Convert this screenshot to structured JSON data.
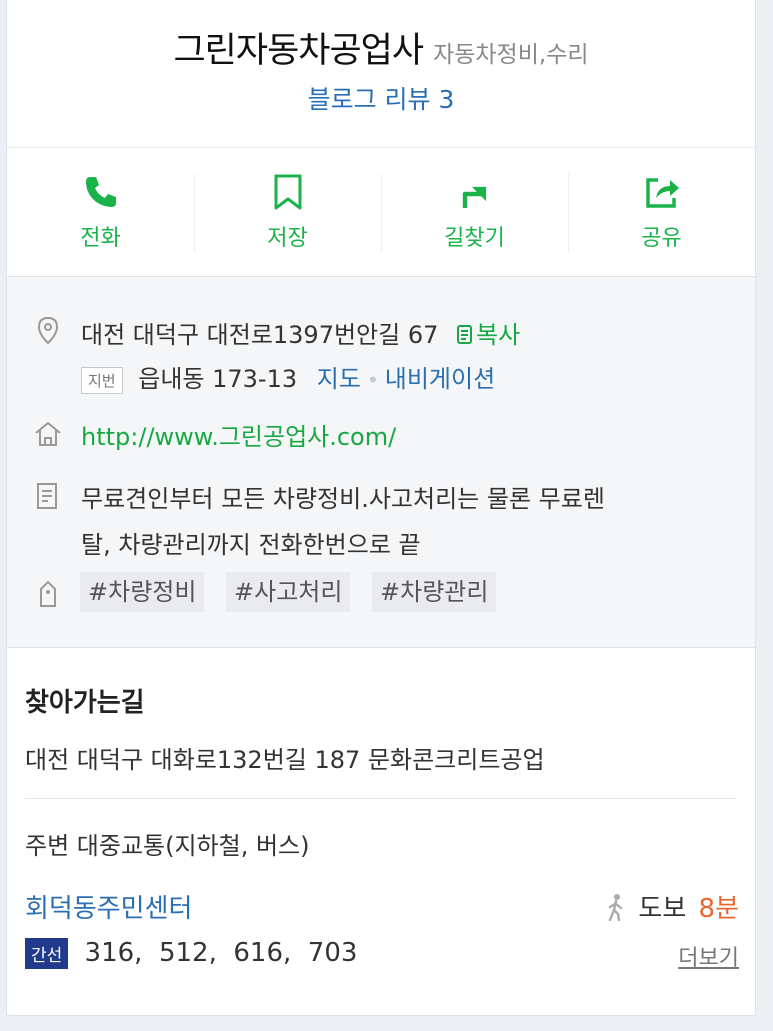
{
  "place": {
    "name": "그린자동차공업사",
    "category": "자동차정비,수리",
    "review_label": "블로그 리뷰 3"
  },
  "actions": [
    {
      "label": "전화",
      "icon": "phone-icon"
    },
    {
      "label": "저장",
      "icon": "bookmark-icon"
    },
    {
      "label": "길찾기",
      "icon": "directions-icon"
    },
    {
      "label": "공유",
      "icon": "share-icon"
    }
  ],
  "info": {
    "road_address": "대전 대덕구 대전로1397번안길 67",
    "copy_label": "복사",
    "jibeon_badge": "지번",
    "jibeon_address": "읍내동 173-13",
    "map_link": "지도",
    "navi_link": "내비게이션",
    "homepage": "http://www.그린공업사.com/",
    "description_line1": "무료견인부터 모든 차량정비.사고처리는 물론 무료렌",
    "description_line2": "탈, 차량관리까지 전화한번으로 끝",
    "tags": [
      "#차량정비",
      "#사고처리",
      "#차량관리"
    ]
  },
  "directions": {
    "title": "찾아가는길",
    "text": "대전 대덕구 대화로132번길 187 문화콘크리트공업"
  },
  "transit": {
    "title": "주변 대중교통(지하철, 버스)",
    "stop_name": "회덕동주민센터",
    "walk_label": "도보",
    "walk_time": "8분",
    "bus_badge": "간선",
    "bus_numbers": "316,  512,  616,  703",
    "more_label": "더보기"
  },
  "colors": {
    "accent_green": "#1ab34a",
    "link_blue": "#2a6fb3",
    "time_orange": "#e8692f",
    "bus_badge_bg": "#213a8c"
  }
}
